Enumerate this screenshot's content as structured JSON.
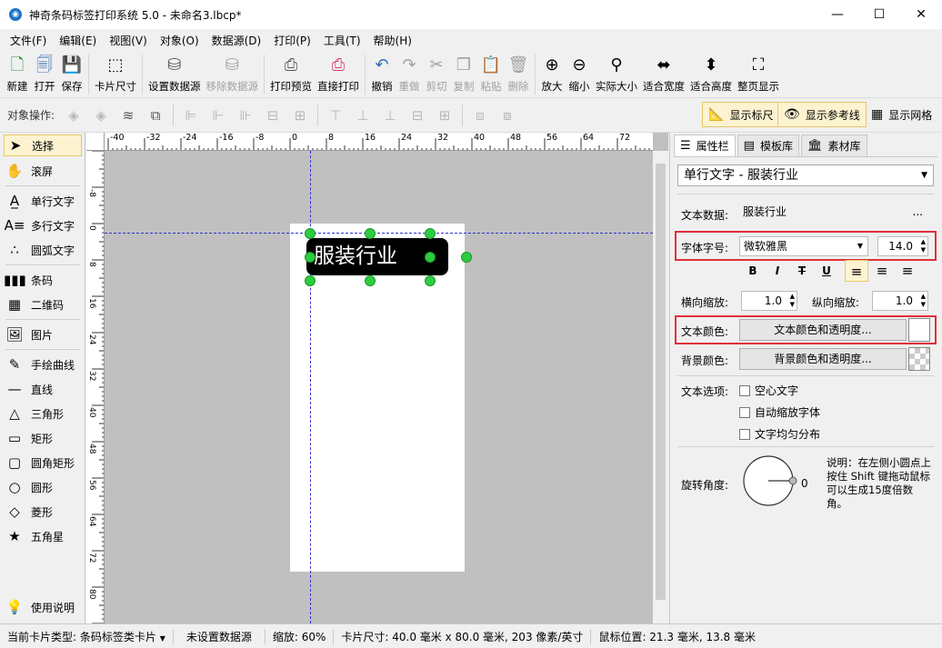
{
  "window": {
    "title": "神奇条码标签打印系统 5.0 - 未命名3.lbcp*",
    "minimize": "—",
    "maximize": "☐",
    "close": "✕"
  },
  "menu": [
    "文件(F)",
    "编辑(E)",
    "视图(V)",
    "对象(O)",
    "数据源(D)",
    "打印(P)",
    "工具(T)",
    "帮助(H)"
  ],
  "toolbar": {
    "new": "新建",
    "open": "打开",
    "save": "保存",
    "card_size": "卡片尺寸",
    "set_datasource": "设置数据源",
    "remove_datasource": "移除数据源",
    "print_preview": "打印预览",
    "direct_print": "直接打印",
    "undo": "撤销",
    "redo": "重做",
    "cut": "剪切",
    "copy": "复制",
    "paste": "粘贴",
    "delete": "删除",
    "zoom_in": "放大",
    "zoom_out": "缩小",
    "actual_size": "实际大小",
    "fit_width": "适合宽度",
    "fit_height": "适合高度",
    "fit_page": "整页显示"
  },
  "objbar": {
    "label": "对象操作:",
    "show_ruler": "显示标尺",
    "show_guides": "显示参考线",
    "show_grid": "显示网格"
  },
  "tools": {
    "select": "选择",
    "scroll": "滚屏",
    "single_text": "单行文字",
    "multi_text": "多行文字",
    "arc_text": "圆弧文字",
    "barcode": "条码",
    "qrcode": "二维码",
    "image": "图片",
    "freehand": "手绘曲线",
    "line": "直线",
    "triangle": "三角形",
    "rect": "矩形",
    "round_rect": "圆角矩形",
    "circle": "圆形",
    "diamond": "菱形",
    "star": "五角星",
    "help": "使用说明"
  },
  "ruler": {
    "h_ticks": [
      "-40",
      "-32",
      "-24",
      "-16",
      "-8",
      "0",
      "8",
      "16",
      "24",
      "32",
      "40",
      "48",
      "56",
      "64",
      "72",
      "80"
    ],
    "v_ticks": [
      "-8",
      "0",
      "8",
      "16",
      "24",
      "32",
      "40",
      "48",
      "56",
      "64",
      "72",
      "80",
      "88"
    ]
  },
  "canvas": {
    "text": "服装行业"
  },
  "panel": {
    "tabs": [
      "属性栏",
      "模板库",
      "素材库"
    ],
    "object_select": "单行文字 - 服装行业",
    "text_data_label": "文本数据:",
    "text_data_value": "服装行业",
    "text_data_more": "...",
    "font_label": "字体字号:",
    "font_name": "微软雅黑",
    "font_size": "14.0",
    "bold": "B",
    "italic": "I",
    "strike": "T",
    "underline": "U",
    "hscale_label": "横向缩放:",
    "hscale": "1.0",
    "vscale_label": "纵向缩放:",
    "vscale": "1.0",
    "text_color_label": "文本颜色:",
    "text_color_btn": "文本颜色和透明度...",
    "bg_color_label": "背景颜色:",
    "bg_color_btn": "背景颜色和透明度...",
    "text_options_label": "文本选项:",
    "opt_hollow": "空心文字",
    "opt_autoscale": "自动缩放字体",
    "opt_distribute": "文字均匀分布",
    "rotate_label": "旋转角度:",
    "rotate_value": "0",
    "rotate_note": "说明：在左侧小圆点上按住 Shift 键拖动鼠标可以生成15度倍数角。"
  },
  "status": {
    "card_type": "当前卡片类型: 条码标签类卡片",
    "datasource": "未设置数据源",
    "zoom": "缩放: 60%",
    "card_size": "卡片尺寸: 40.0 毫米 x 80.0 毫米, 203 像素/英寸",
    "mouse_pos": "鼠标位置: 21.3 毫米, 13.8 毫米"
  },
  "colors": {
    "accent_red": "#e0303a",
    "handle_green": "#2ecc40",
    "guide_blue": "#3030d0"
  }
}
